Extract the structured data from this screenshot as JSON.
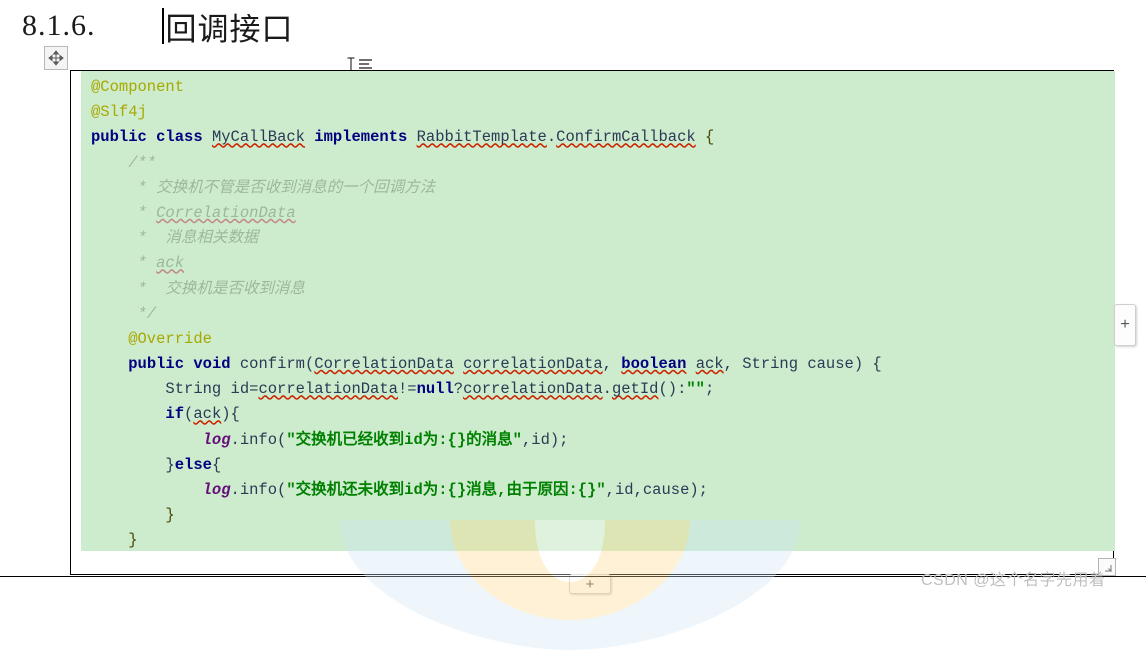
{
  "document": {
    "heading": {
      "number": "8.1.6.",
      "title": "回调接口",
      "caret_visible": true
    }
  },
  "icons": {
    "move_handle": "move-4way-icon",
    "text_cursor": "i-beam-text-cursor-icon",
    "add_column": "plus-icon",
    "add_row": "plus-icon",
    "resize_grip": "resize-handle-icon"
  },
  "buttons": {
    "add_column_label": "+",
    "add_row_label": "+"
  },
  "code": {
    "language": "java",
    "lines": [
      {
        "id": 1,
        "segments": [
          {
            "t": "@Component",
            "c": "anno"
          }
        ]
      },
      {
        "id": 2,
        "segments": [
          {
            "t": "@Slf4j",
            "c": "anno"
          }
        ]
      },
      {
        "id": 3,
        "segments": [
          {
            "t": "public",
            "c": "kw"
          },
          {
            "t": " ",
            "c": "plain"
          },
          {
            "t": "class",
            "c": "kw"
          },
          {
            "t": " ",
            "c": "plain"
          },
          {
            "t": "MyCallBack",
            "c": "ident sq"
          },
          {
            "t": " ",
            "c": "plain"
          },
          {
            "t": "implements",
            "c": "kw"
          },
          {
            "t": " ",
            "c": "plain"
          },
          {
            "t": "RabbitTemplate",
            "c": "ident sq"
          },
          {
            "t": ".",
            "c": "plain"
          },
          {
            "t": "ConfirmCallback",
            "c": "ident sq"
          },
          {
            "t": " ",
            "c": "plain"
          },
          {
            "t": "{",
            "c": "brace"
          }
        ]
      },
      {
        "id": 4,
        "segments": [
          {
            "t": "    /**",
            "c": "jdocmark"
          }
        ]
      },
      {
        "id": 5,
        "segments": [
          {
            "t": "     * 交换机不管是否收到消息的一个回调方法",
            "c": "jdoc"
          }
        ]
      },
      {
        "id": 6,
        "segments": [
          {
            "t": "     * ",
            "c": "jdoc"
          },
          {
            "t": "CorrelationData",
            "c": "jdoc sq-gray"
          }
        ]
      },
      {
        "id": 7,
        "segments": [
          {
            "t": "     *  消息相关数据",
            "c": "jdoc"
          }
        ]
      },
      {
        "id": 8,
        "segments": [
          {
            "t": "     * ",
            "c": "jdoc"
          },
          {
            "t": "ack",
            "c": "jdoc sq-gray"
          }
        ]
      },
      {
        "id": 9,
        "segments": [
          {
            "t": "     *  交换机是否收到消息",
            "c": "jdoc"
          }
        ]
      },
      {
        "id": 10,
        "segments": [
          {
            "t": "     */",
            "c": "jdocmark"
          }
        ]
      },
      {
        "id": 11,
        "segments": [
          {
            "t": "    @Override",
            "c": "anno"
          }
        ]
      },
      {
        "id": 12,
        "segments": [
          {
            "t": "    ",
            "c": "plain"
          },
          {
            "t": "public",
            "c": "kw"
          },
          {
            "t": " ",
            "c": "plain"
          },
          {
            "t": "void",
            "c": "kw"
          },
          {
            "t": " confirm(",
            "c": "plain"
          },
          {
            "t": "CorrelationData",
            "c": "ident sq"
          },
          {
            "t": " ",
            "c": "plain"
          },
          {
            "t": "correlationData",
            "c": "ident sq"
          },
          {
            "t": ", ",
            "c": "plain"
          },
          {
            "t": "boolean",
            "c": "kw sq"
          },
          {
            "t": " ",
            "c": "plain"
          },
          {
            "t": "ack",
            "c": "ident sq"
          },
          {
            "t": ", String cause) {",
            "c": "plain"
          }
        ]
      },
      {
        "id": 13,
        "segments": [
          {
            "t": "        String id=",
            "c": "plain"
          },
          {
            "t": "correlationData",
            "c": "ident sq"
          },
          {
            "t": "!=",
            "c": "plain"
          },
          {
            "t": "null",
            "c": "kw"
          },
          {
            "t": "?",
            "c": "plain"
          },
          {
            "t": "correlationData",
            "c": "ident sq"
          },
          {
            "t": ".",
            "c": "plain"
          },
          {
            "t": "getId",
            "c": "ident sq"
          },
          {
            "t": "():",
            "c": "plain"
          },
          {
            "t": "\"\"",
            "c": "str"
          },
          {
            "t": ";",
            "c": "plain"
          }
        ]
      },
      {
        "id": 14,
        "segments": [
          {
            "t": "        ",
            "c": "plain"
          },
          {
            "t": "if",
            "c": "kw"
          },
          {
            "t": "(",
            "c": "plain"
          },
          {
            "t": "ack",
            "c": "ident sq"
          },
          {
            "t": "){",
            "c": "plain"
          }
        ]
      },
      {
        "id": 15,
        "segments": [
          {
            "t": "            ",
            "c": "plain"
          },
          {
            "t": "log",
            "c": "field"
          },
          {
            "t": ".info(",
            "c": "plain"
          },
          {
            "t": "\"交换机已经收到id为:{}的消息\"",
            "c": "str"
          },
          {
            "t": ",id);",
            "c": "plain"
          }
        ]
      },
      {
        "id": 16,
        "segments": [
          {
            "t": "        }",
            "c": "plain"
          },
          {
            "t": "else",
            "c": "kw"
          },
          {
            "t": "{",
            "c": "plain"
          }
        ]
      },
      {
        "id": 17,
        "segments": [
          {
            "t": "            ",
            "c": "plain"
          },
          {
            "t": "log",
            "c": "field"
          },
          {
            "t": ".info(",
            "c": "plain"
          },
          {
            "t": "\"交换机还未收到id为:{}消息,由于原因:{}\"",
            "c": "str"
          },
          {
            "t": ",id,cause);",
            "c": "plain"
          }
        ]
      },
      {
        "id": 18,
        "segments": [
          {
            "t": "        }",
            "c": "brace"
          }
        ]
      },
      {
        "id": 19,
        "segments": [
          {
            "t": "    }",
            "c": "brace"
          }
        ]
      },
      {
        "id": 20,
        "segments": [
          {
            "t": "",
            "c": "plain"
          }
        ]
      },
      {
        "id": 21,
        "segments": [
          {
            "t": "}",
            "c": "brace"
          }
        ]
      }
    ]
  },
  "watermark": {
    "text": "CSDN @这个名字先用着"
  },
  "colors": {
    "code_background": "#cdeccd",
    "keyword": "#000080",
    "annotation": "#a8a800",
    "string": "#008000",
    "static_field": "#660e7a",
    "javadoc": "#9cb89c",
    "identifier": "#2b3a55",
    "spellcheck_underline": "#cc2200",
    "watermark": "#bfbfbf"
  }
}
